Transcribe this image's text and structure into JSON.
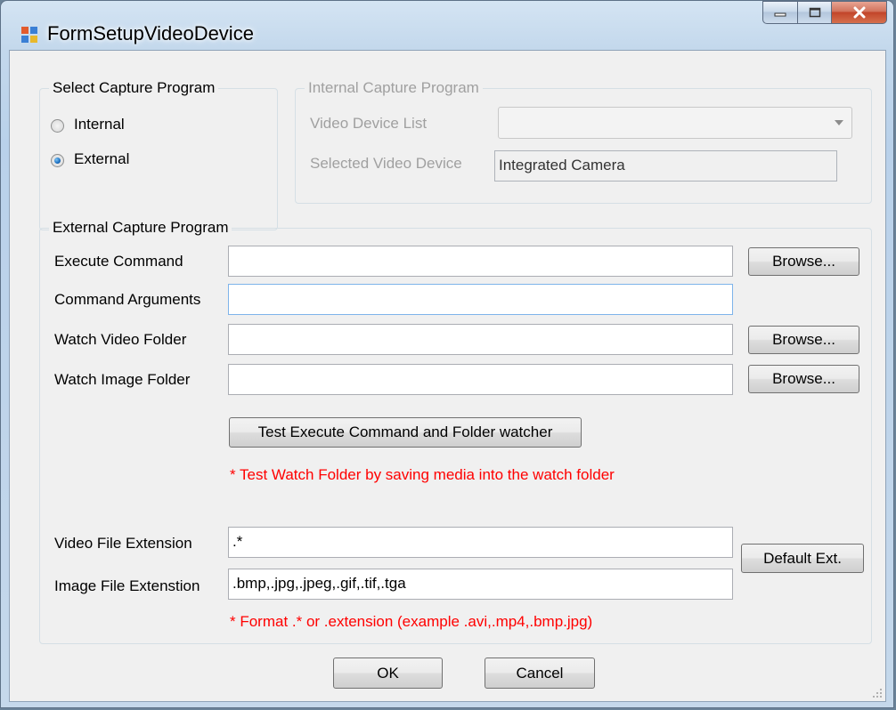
{
  "window": {
    "title": "FormSetupVideoDevice",
    "icon": "app-form-icon",
    "controls": [
      "minimize-icon",
      "maximize-icon",
      "close-icon"
    ]
  },
  "select_capture": {
    "title": "Select Capture Program",
    "options": [
      {
        "label": "Internal",
        "selected": false
      },
      {
        "label": "External",
        "selected": true
      }
    ]
  },
  "internal_capture": {
    "title": "Internal Capture Program",
    "device_list_label": "Video Device List",
    "device_list_value": "",
    "selected_device_label": "Selected Video Device",
    "selected_device_value": "Integrated Camera"
  },
  "external_capture": {
    "title": "External Capture Program",
    "execute_command_label": "Execute Command",
    "execute_command_value": "",
    "command_arguments_label": "Command Arguments",
    "command_arguments_value": "",
    "watch_video_label": "Watch Video Folder",
    "watch_video_value": "",
    "watch_image_label": "Watch Image Folder",
    "watch_image_value": "",
    "browse_label": "Browse...",
    "test_button_label": "Test Execute Command and Folder watcher",
    "test_note": "* Test Watch Folder by saving media into the watch folder",
    "video_ext_label": "Video File Extension",
    "video_ext_value": ".*",
    "image_ext_label": "Image File Extenstion",
    "image_ext_value": ".bmp,.jpg,.jpeg,.gif,.tif,.tga",
    "default_ext_label": "Default Ext.",
    "format_note": "* Format .* or .extension (example .avi,.mp4,.bmp.jpg)"
  },
  "footer": {
    "ok_label": "OK",
    "cancel_label": "Cancel"
  },
  "colors": {
    "note": "#ff0000",
    "disabled_text": "#a0a0a0",
    "dialog_bg": "#f0f0f0"
  }
}
